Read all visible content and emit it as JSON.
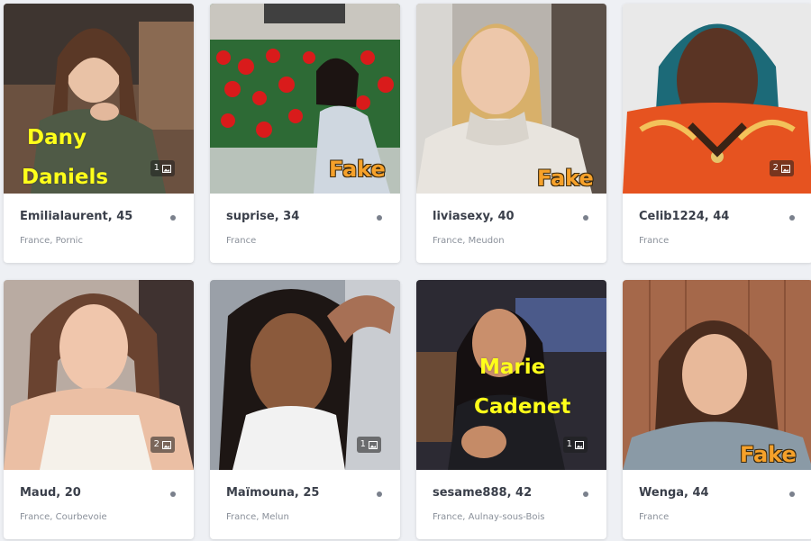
{
  "colors": {
    "page_bg": "#eef0f4",
    "card_bg": "#ffffff",
    "name_overlay": "#ffff1a",
    "fake_overlay": "#f6a12a",
    "status_dot": "#7a808c"
  },
  "icons": {
    "photo_count": "image-icon",
    "status": "status-dot-icon"
  },
  "profiles": [
    {
      "title": "Emilialaurent, 45",
      "location": "France, Pornic",
      "photo_count": "1",
      "overlay": [
        "Dany",
        "Daniels"
      ]
    },
    {
      "title": "suprise, 34",
      "location": "France",
      "photo_count": "",
      "overlay": [
        "Fake"
      ]
    },
    {
      "title": "liviasexy, 40",
      "location": "France, Meudon",
      "photo_count": "",
      "overlay": [
        "Fake"
      ]
    },
    {
      "title": "Celib1224, 44",
      "location": "France",
      "photo_count": "2",
      "overlay": []
    },
    {
      "title": "Maud, 20",
      "location": "France, Courbevoie",
      "photo_count": "2",
      "overlay": []
    },
    {
      "title": "Maïmouna, 25",
      "location": "France, Melun",
      "photo_count": "1",
      "overlay": []
    },
    {
      "title": "sesame888, 42",
      "location": "France, Aulnay-sous-Bois",
      "photo_count": "1",
      "overlay": [
        "Marie",
        "Cadenet"
      ]
    },
    {
      "title": "Wenga, 44",
      "location": "France",
      "photo_count": "",
      "overlay": [
        "Fake"
      ]
    }
  ]
}
